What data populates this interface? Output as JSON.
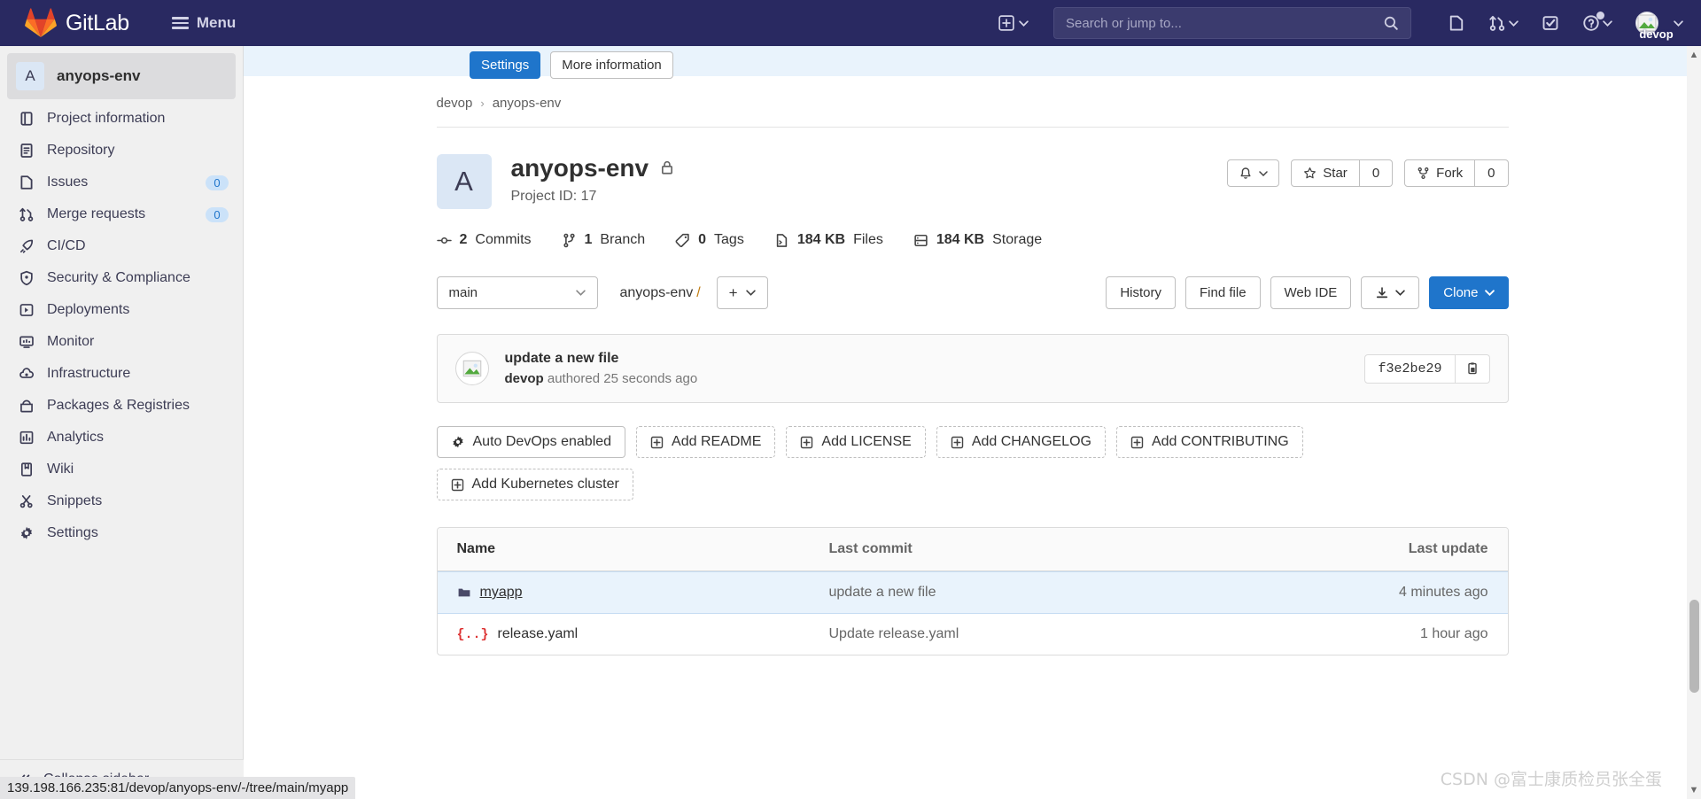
{
  "navbar": {
    "brand": "GitLab",
    "menu_label": "Menu",
    "search_placeholder": "Search or jump to...",
    "icons": [
      {
        "name": "plus-square-icon",
        "label": "+"
      },
      {
        "name": "issues-icon",
        "label": ""
      },
      {
        "name": "merge-requests-icon",
        "label": ""
      },
      {
        "name": "todos-icon",
        "label": ""
      },
      {
        "name": "help-icon",
        "label": ""
      }
    ],
    "user_name": "devop"
  },
  "sidebar": {
    "project_initial": "A",
    "project_name": "anyops-env",
    "items": [
      {
        "label": "Project information",
        "icon": "project-info-icon",
        "badge": ""
      },
      {
        "label": "Repository",
        "icon": "repository-icon",
        "badge": ""
      },
      {
        "label": "Issues",
        "icon": "issues-icon",
        "badge": "0"
      },
      {
        "label": "Merge requests",
        "icon": "merge-requests-icon",
        "badge": "0"
      },
      {
        "label": "CI/CD",
        "icon": "rocket-icon",
        "badge": ""
      },
      {
        "label": "Security & Compliance",
        "icon": "shield-icon",
        "badge": ""
      },
      {
        "label": "Deployments",
        "icon": "deployments-icon",
        "badge": ""
      },
      {
        "label": "Monitor",
        "icon": "monitor-icon",
        "badge": ""
      },
      {
        "label": "Infrastructure",
        "icon": "cloud-gear-icon",
        "badge": ""
      },
      {
        "label": "Packages & Registries",
        "icon": "package-icon",
        "badge": ""
      },
      {
        "label": "Analytics",
        "icon": "chart-icon",
        "badge": ""
      },
      {
        "label": "Wiki",
        "icon": "book-icon",
        "badge": ""
      },
      {
        "label": "Snippets",
        "icon": "scissors-icon",
        "badge": ""
      },
      {
        "label": "Settings",
        "icon": "gear-icon",
        "badge": ""
      }
    ],
    "collapse_label": "Collapse sidebar"
  },
  "banner": {
    "settings_label": "Settings",
    "more_info_label": "More information"
  },
  "breadcrumb": {
    "group": "devop",
    "separator": "›",
    "project": "anyops-env"
  },
  "project": {
    "initial": "A",
    "title": "anyops-env",
    "visibility_icon": "lock-icon",
    "project_id_label": "Project ID: 17",
    "notification_icon": "bell-icon",
    "star_label": "Star",
    "star_count": "0",
    "fork_label": "Fork",
    "fork_count": "0"
  },
  "stats": [
    {
      "icon": "commit-icon",
      "value": "2",
      "label": "Commits"
    },
    {
      "icon": "branch-icon",
      "value": "1",
      "label": "Branch"
    },
    {
      "icon": "tag-icon",
      "value": "0",
      "label": "Tags"
    },
    {
      "icon": "file-icon",
      "value": "184 KB",
      "label": "Files"
    },
    {
      "icon": "storage-icon",
      "value": "184 KB",
      "label": "Storage"
    }
  ],
  "repo_bar": {
    "branch": "main",
    "path_project": "anyops-env",
    "path_slash": "/",
    "plus_label": "+",
    "history_label": "History",
    "find_file_label": "Find file",
    "web_ide_label": "Web IDE",
    "download_icon": "download-icon",
    "clone_label": "Clone"
  },
  "commit": {
    "title": "update a new file",
    "author": "devop",
    "meta_suffix": "authored 25 seconds ago",
    "sha": "f3e2be29",
    "copy_icon": "clipboard-icon"
  },
  "add_buttons": [
    {
      "label": "Auto DevOps enabled",
      "icon": "gear-icon",
      "style": "solid"
    },
    {
      "label": "Add README",
      "icon": "plus-box-icon",
      "style": "dashed"
    },
    {
      "label": "Add LICENSE",
      "icon": "plus-box-icon",
      "style": "dashed"
    },
    {
      "label": "Add CHANGELOG",
      "icon": "plus-box-icon",
      "style": "dashed"
    },
    {
      "label": "Add CONTRIBUTING",
      "icon": "plus-box-icon",
      "style": "dashed"
    },
    {
      "label": "Add Kubernetes cluster",
      "icon": "plus-box-icon",
      "style": "dashed"
    }
  ],
  "file_table": {
    "headers": {
      "name": "Name",
      "last_commit": "Last commit",
      "last_update": "Last update"
    },
    "rows": [
      {
        "name": "myapp",
        "type": "folder",
        "icon": "folder-icon",
        "last_commit": "update a new file",
        "last_update": "4 minutes ago",
        "highlighted": true
      },
      {
        "name": "release.yaml",
        "type": "file",
        "icon": "yaml-file-icon",
        "last_commit": "Update release.yaml",
        "last_update": "1 hour ago",
        "highlighted": false
      }
    ]
  },
  "statusbar": {
    "url": "139.198.166.235:81/devop/anyops-env/-/tree/main/myapp"
  },
  "watermark": {
    "text": "CSDN @富士康质检员张全蛋"
  }
}
